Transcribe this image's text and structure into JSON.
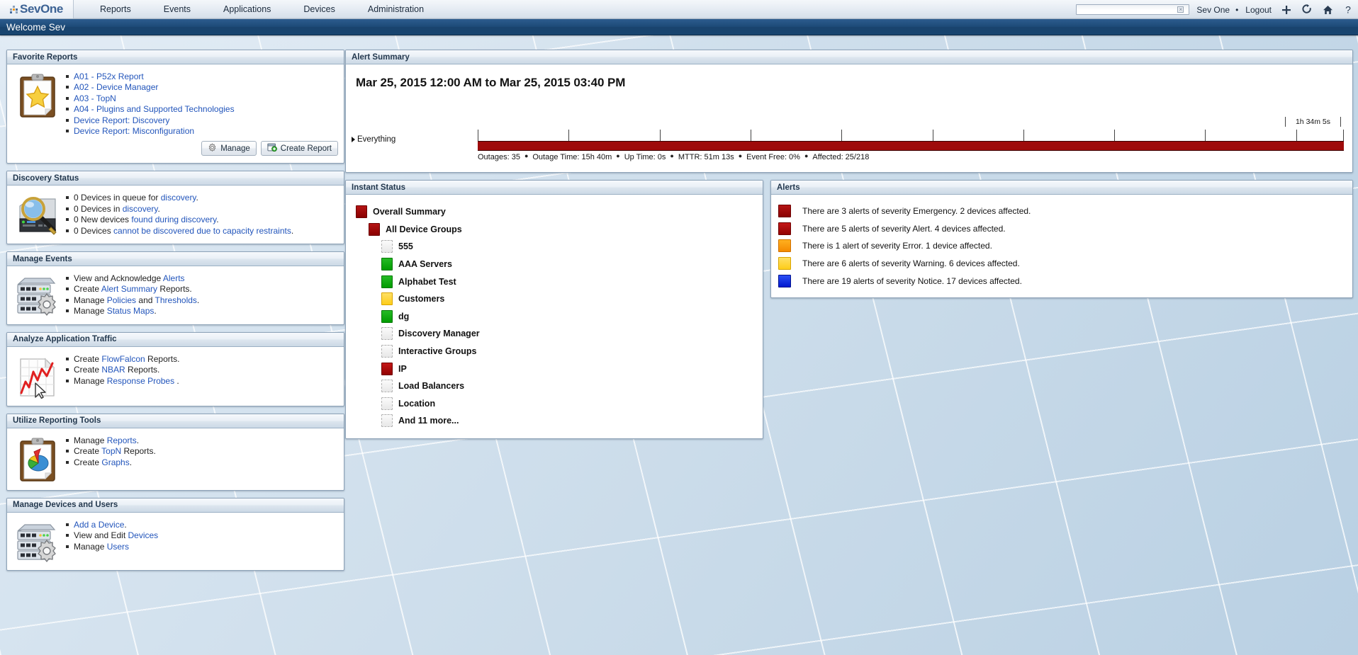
{
  "brand": {
    "name": "SevOne",
    "name_part1": "Sev",
    "name_part2": "One"
  },
  "topnav": {
    "items": [
      {
        "label": "Reports",
        "name": "nav-reports"
      },
      {
        "label": "Events",
        "name": "nav-events"
      },
      {
        "label": "Applications",
        "name": "nav-applications"
      },
      {
        "label": "Devices",
        "name": "nav-devices"
      },
      {
        "label": "Administration",
        "name": "nav-administration"
      }
    ],
    "search": {
      "value": "",
      "placeholder": "",
      "clear_glyph": "×"
    },
    "user": "Sev One",
    "separator": "•",
    "logout": "Logout",
    "icons": [
      {
        "label": "add-icon",
        "glyph": "+"
      },
      {
        "label": "refresh-icon",
        "glyph": "↻"
      },
      {
        "label": "home-icon",
        "glyph": "⌂"
      },
      {
        "label": "help-icon",
        "glyph": "?"
      }
    ]
  },
  "welcome": {
    "text": "Welcome Sev"
  },
  "favorite_reports": {
    "title": "Favorite Reports",
    "items": [
      "A01 - P52x Report",
      "A02 - Device Manager",
      "A03 - TopN",
      "A04 - Plugins and Supported Technologies",
      "Device Report: Discovery",
      "Device Report: Misconfiguration"
    ],
    "manage_button": "Manage",
    "create_button": "Create Report"
  },
  "discovery_status": {
    "title": "Discovery Status",
    "items": [
      {
        "pre": "0 Devices in queue for ",
        "link": "discovery",
        "post": "."
      },
      {
        "pre": "0 Devices in ",
        "link": "discovery",
        "post": "."
      },
      {
        "pre": "0 New devices ",
        "link": "found during discovery",
        "post": "."
      },
      {
        "pre": "0 Devices ",
        "link": "cannot be discovered due to capacity restraints",
        "post": "."
      }
    ]
  },
  "manage_events": {
    "title": "Manage Events",
    "items": [
      {
        "pre": "View and Acknowledge ",
        "link": "Alerts",
        "post": ""
      },
      {
        "pre": "Create ",
        "link": "Alert Summary",
        "post": " Reports."
      },
      {
        "pre": "Manage ",
        "link": "Policies",
        "mid": " and ",
        "link2": "Thresholds",
        "post": "."
      },
      {
        "pre": "Manage ",
        "link": "Status Maps",
        "post": "."
      }
    ]
  },
  "analyze_traffic": {
    "title": "Analyze Application Traffic",
    "items": [
      {
        "pre": "Create ",
        "link": "FlowFalcon",
        "post": " Reports."
      },
      {
        "pre": "Create ",
        "link": "NBAR",
        "post": " Reports."
      },
      {
        "pre": "Manage ",
        "link": "Response Probes",
        "post": " ."
      }
    ]
  },
  "reporting_tools": {
    "title": "Utilize Reporting Tools",
    "items": [
      {
        "pre": "Manage ",
        "link": "Reports",
        "post": "."
      },
      {
        "pre": "Create ",
        "link": "TopN",
        "post": " Reports."
      },
      {
        "pre": "Create ",
        "link": "Graphs",
        "post": "."
      }
    ]
  },
  "devices_users": {
    "title": "Manage Devices and Users",
    "items": [
      {
        "pre": "",
        "link": "Add a Device",
        "post": "."
      },
      {
        "pre": "View and Edit ",
        "link": "Devices",
        "post": ""
      },
      {
        "pre": "Manage ",
        "link": "Users",
        "post": ""
      }
    ]
  },
  "alert_summary": {
    "title": "Alert Summary",
    "range_title": "Mar 25, 2015 12:00 AM to Mar 25, 2015 03:40 PM",
    "row_label": "Everything",
    "duration_label": "1h 34m 5s",
    "stats": [
      "Outages: 35",
      "Outage Time: 15h 40m",
      "Up Time: 0s",
      "MTTR: 51m 13s",
      "Event Free: 0%",
      "Affected: 25/218"
    ],
    "bar_color": "#9e0b0b"
  },
  "instant_status": {
    "title": "Instant Status",
    "rows": [
      {
        "label": "Overall Summary",
        "status": "darkred",
        "indent": 0
      },
      {
        "label": "All Device Groups",
        "status": "darkred",
        "indent": 1
      },
      {
        "label": "555",
        "status": "none",
        "indent": 2
      },
      {
        "label": "AAA Servers",
        "status": "green",
        "indent": 2
      },
      {
        "label": "Alphabet Test",
        "status": "green",
        "indent": 2
      },
      {
        "label": "Customers",
        "status": "yellow",
        "indent": 2
      },
      {
        "label": "dg",
        "status": "green",
        "indent": 2
      },
      {
        "label": "Discovery Manager",
        "status": "none",
        "indent": 2
      },
      {
        "label": "Interactive Groups",
        "status": "none",
        "indent": 2
      },
      {
        "label": "IP",
        "status": "red",
        "indent": 2
      },
      {
        "label": "Load Balancers",
        "status": "none",
        "indent": 2
      },
      {
        "label": "Location",
        "status": "none",
        "indent": 2
      },
      {
        "label": "And 11 more...",
        "status": "none",
        "indent": 2
      }
    ]
  },
  "alerts": {
    "title": "Alerts",
    "rows": [
      {
        "severity": "Emergency",
        "color": "darkred",
        "text": "There are 3 alerts of severity Emergency. 2 devices affected."
      },
      {
        "severity": "Alert",
        "color": "red",
        "text": "There are 5 alerts of severity Alert. 4 devices affected."
      },
      {
        "severity": "Error",
        "color": "orange",
        "text": "There is 1 alert of severity Error. 1 device affected."
      },
      {
        "severity": "Warning",
        "color": "yellow",
        "text": "There are 6 alerts of severity Warning. 6 devices affected."
      },
      {
        "severity": "Notice",
        "color": "blue",
        "text": "There are 19 alerts of severity Notice. 17 devices affected."
      }
    ]
  },
  "colors": {
    "brand_blue": "#3c6294",
    "welcome_bar": "#1d4a78",
    "severity_emergency": "#8a0000",
    "severity_alert": "#c41717",
    "severity_error": "#f58a00",
    "severity_warning": "#fdcd19",
    "severity_notice": "#0018cf",
    "status_ok": "#019c01",
    "link": "#2255bb"
  }
}
